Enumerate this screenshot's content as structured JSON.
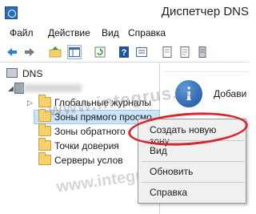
{
  "window": {
    "title": "Диспетчер DNS"
  },
  "menu": [
    "Файл",
    "Действие",
    "Вид",
    "Справка"
  ],
  "toolbar": {
    "buttons": [
      "back-icon",
      "forward-icon",
      "up-folder-icon",
      "show-hide-tree-icon",
      "refresh-icon",
      "help-icon",
      "properties-icon",
      "new-record-icon",
      "new-zone-icon",
      "server-icon"
    ]
  },
  "tree": {
    "root": "DNS",
    "items": [
      "Глобальные журналы",
      "Зоны прямого просмо",
      "Зоны обратного",
      "Точки доверия",
      "Серверы услов"
    ]
  },
  "info": {
    "title": "Добави"
  },
  "context_menu": {
    "items": [
      "Создать новую зону...",
      "Вид",
      "Обновить",
      "Справка"
    ]
  },
  "watermark": "www.integrus.ru",
  "colors": {
    "highlight": "#cce4f7",
    "annotation_ellipse": "#d7262d",
    "folder": "#f5d06b"
  }
}
